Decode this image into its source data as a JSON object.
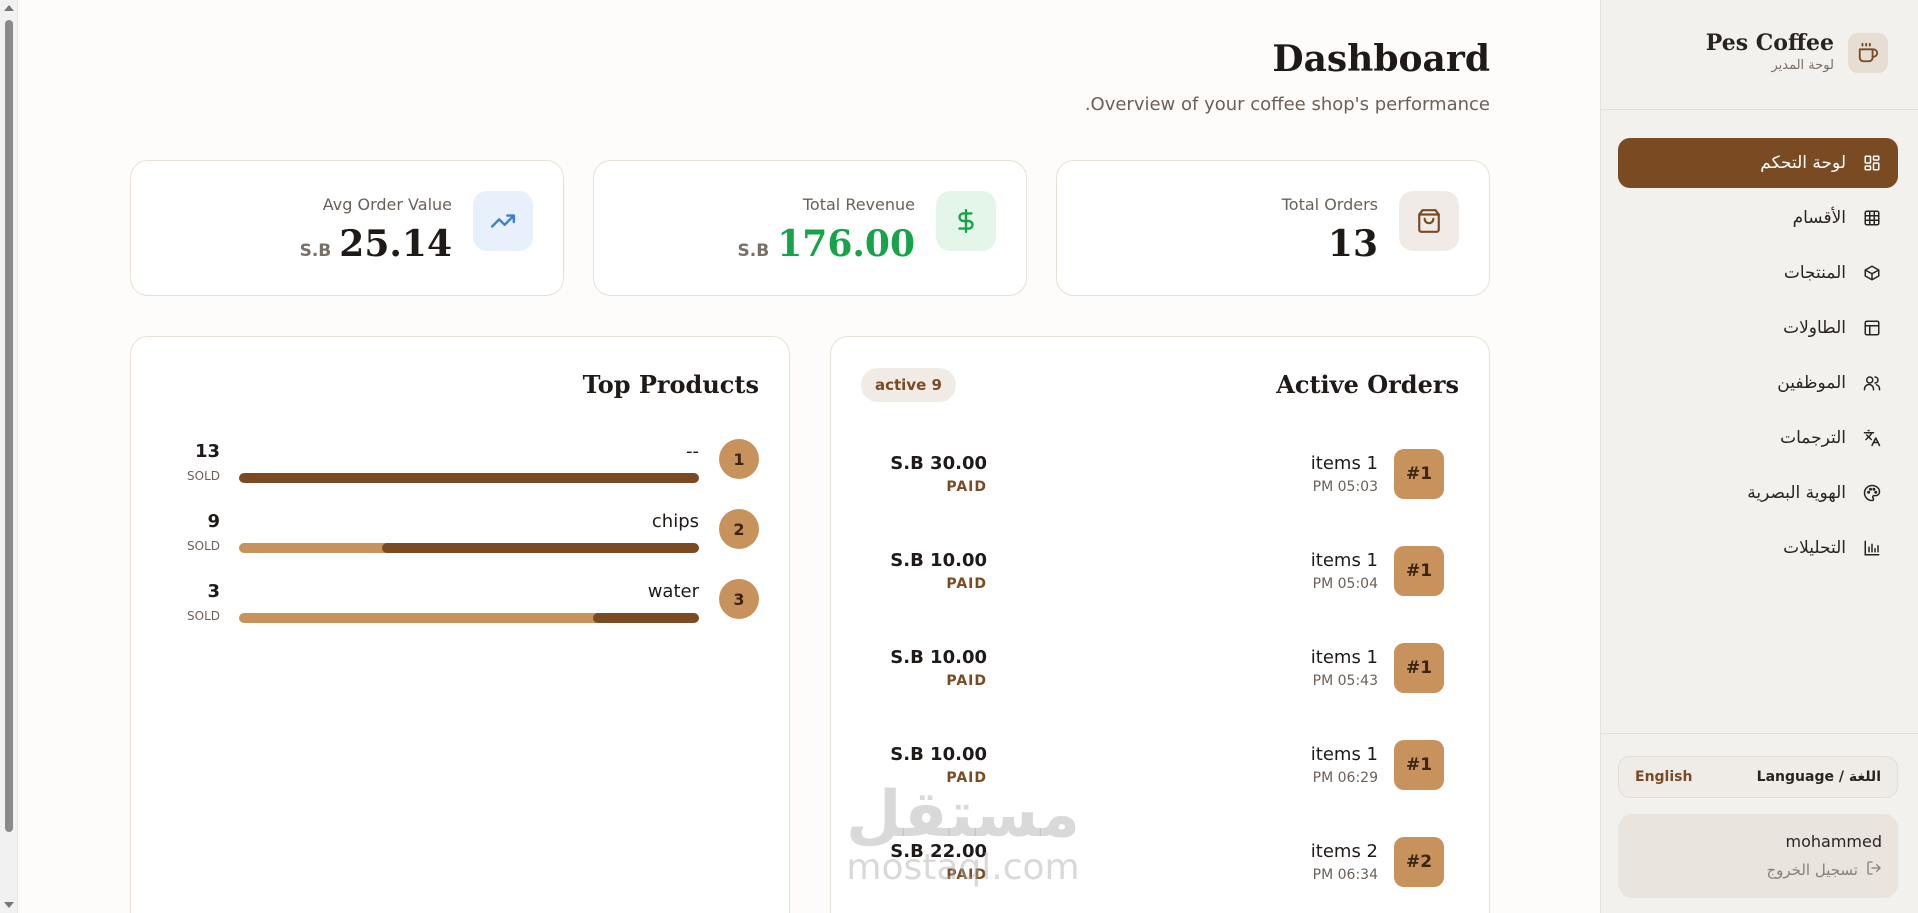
{
  "sidebar": {
    "brand_name": "Pes Coffee",
    "brand_sub": "لوحة المدير",
    "items": [
      {
        "label": "لوحة التحكم",
        "icon": "dashboard-grid-icon",
        "active": true
      },
      {
        "label": "الأقسام",
        "icon": "categories-grid-icon",
        "active": false
      },
      {
        "label": "المنتجات",
        "icon": "box-icon",
        "active": false
      },
      {
        "label": "الطاولات",
        "icon": "table-icon",
        "active": false
      },
      {
        "label": "الموظفين",
        "icon": "users-icon",
        "active": false
      },
      {
        "label": "الترجمات",
        "icon": "translate-icon",
        "active": false
      },
      {
        "label": "الهوية البصرية",
        "icon": "palette-icon",
        "active": false
      },
      {
        "label": "التحليلات",
        "icon": "bar-chart-icon",
        "active": false
      }
    ],
    "language_label": "Language / اللغة",
    "language_value": "English",
    "user_name": "mohammed",
    "logout_label": "تسجيل الخروج"
  },
  "header": {
    "title": "Dashboard",
    "subtitle": ".Overview of your coffee shop's performance"
  },
  "stats": [
    {
      "label": "Total Orders",
      "value": "13",
      "currency": "",
      "icon": "shopping-bag-icon",
      "value_color": "#1f1a17"
    },
    {
      "label": "Total Revenue",
      "value": "176.00",
      "currency": "S.B",
      "icon": "dollar-icon",
      "value_color": "#16a34a"
    },
    {
      "label": "Avg Order Value",
      "value": "25.14",
      "currency": "S.B",
      "icon": "trending-up-icon",
      "value_color": "#1f1a17"
    }
  ],
  "active_orders": {
    "title": "Active Orders",
    "badge": "active 9",
    "orders": [
      {
        "number": "#1",
        "items": "items 1",
        "time": "PM 05:03",
        "total": "S.B 30.00",
        "status": "PAID"
      },
      {
        "number": "#1",
        "items": "items 1",
        "time": "PM 05:04",
        "total": "S.B 10.00",
        "status": "PAID"
      },
      {
        "number": "#1",
        "items": "items 1",
        "time": "PM 05:43",
        "total": "S.B 10.00",
        "status": "PAID"
      },
      {
        "number": "#1",
        "items": "items 1",
        "time": "PM 06:29",
        "total": "S.B 10.00",
        "status": "PAID"
      },
      {
        "number": "#2",
        "items": "items 2",
        "time": "PM 06:34",
        "total": "S.B 22.00",
        "status": "PAID"
      }
    ]
  },
  "top_products": {
    "title": "Top Products",
    "sold_label": "SOLD",
    "products": [
      {
        "rank": "1",
        "name": "--",
        "count": "13",
        "share": 1.0
      },
      {
        "rank": "2",
        "name": "chips",
        "count": "9",
        "share": 0.69
      },
      {
        "rank": "3",
        "name": "water",
        "count": "3",
        "share": 0.23
      }
    ]
  },
  "watermark": {
    "line1": "مستقل",
    "line2": "mostaql.com"
  },
  "colors": {
    "accent": "#7a4a23",
    "tan": "#c7925b",
    "revenue": "#16a34a"
  }
}
